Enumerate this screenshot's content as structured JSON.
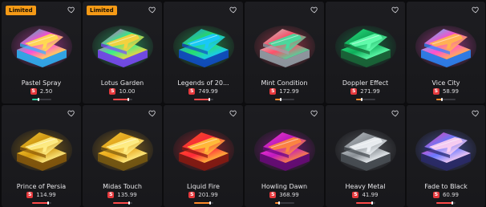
{
  "cases": [
    {
      "name": "Pastel Spray",
      "price": "2.50",
      "badge": "Limited",
      "palette": [
        "#19d6b0",
        "#ff4fd8",
        "#ffe14a",
        "#2fb9ff"
      ],
      "bar_color": "#2ed0a0",
      "bar_level": 0.35
    },
    {
      "name": "Lotus Garden",
      "price": "10.00",
      "badge": "Limited",
      "palette": [
        "#ff3fd8",
        "#36f08a",
        "#ffcf3a",
        "#7f4bff"
      ],
      "bar_color": "#ff4a4a",
      "bar_level": 0.8
    },
    {
      "name": "Legends of 20...",
      "price": "749.99",
      "badge": "",
      "palette": [
        "#1f8cff",
        "#28e06a",
        "#18c6ff",
        "#0e4fd0"
      ],
      "bar_color": "#ff4a4a",
      "bar_level": 0.8
    },
    {
      "name": "Mint Condition",
      "price": "172.99",
      "badge": "",
      "palette": [
        "#c9e8dc",
        "#ff4f6a",
        "#3fe0a0",
        "#9aa8b0"
      ],
      "bar_color": "#ff8a2a",
      "bar_level": 0.3
    },
    {
      "name": "Doppler Effect",
      "price": "271.99",
      "badge": "",
      "palette": [
        "#2ef28a",
        "#0fae5a",
        "#66ffb0",
        "#1a6a3a"
      ],
      "bar_color": "#ff8a2a",
      "bar_level": 0.3
    },
    {
      "name": "Vice City",
      "price": "58.99",
      "badge": "",
      "palette": [
        "#3fd9ff",
        "#ff4fd0",
        "#ffb84a",
        "#2a8aff"
      ],
      "bar_color": "#ff8a2a",
      "bar_level": 0.3
    },
    {
      "name": "Prince of Persia",
      "price": "114.99",
      "badge": "",
      "palette": [
        "#ffd23a",
        "#d49a10",
        "#ffef8a",
        "#8a5a0a"
      ],
      "bar_color": "#ff4a4a",
      "bar_level": 0.85
    },
    {
      "name": "Midas Touch",
      "price": "135.99",
      "badge": "",
      "palette": [
        "#ffd23a",
        "#e8a81c",
        "#fff08a",
        "#7a5a10"
      ],
      "bar_color": "#ff4a4a",
      "bar_level": 0.85
    },
    {
      "name": "Liquid Fire",
      "price": "201.99",
      "badge": "",
      "palette": [
        "#ff5a1a",
        "#ff2a3a",
        "#ffc23a",
        "#8a1a10"
      ],
      "bar_color": "#ff8a2a",
      "bar_level": 0.85
    },
    {
      "name": "Howling Dawn",
      "price": "368.99",
      "badge": "",
      "palette": [
        "#ff3fd8",
        "#c01ac0",
        "#ff8a3a",
        "#6a0a7a"
      ],
      "bar_color": "#ff8a2a",
      "bar_level": 0.2
    },
    {
      "name": "Heavy Metal",
      "price": "41.99",
      "badge": "",
      "palette": [
        "#c8cdd2",
        "#8a9096",
        "#eef2f5",
        "#4a5056"
      ],
      "bar_color": "#ff4a4a",
      "bar_level": 0.85
    },
    {
      "name": "Fade to Black",
      "price": "60.99",
      "badge": "",
      "palette": [
        "#ff3fb0",
        "#6a7aff",
        "#ffd0f0",
        "#2a2a6a"
      ],
      "bar_color": "#ff4a4a",
      "bar_level": 0.85
    }
  ],
  "currency_icon": "coin-s-icon",
  "favorite_icon": "heart-outline-icon",
  "coin_glyph": "S"
}
